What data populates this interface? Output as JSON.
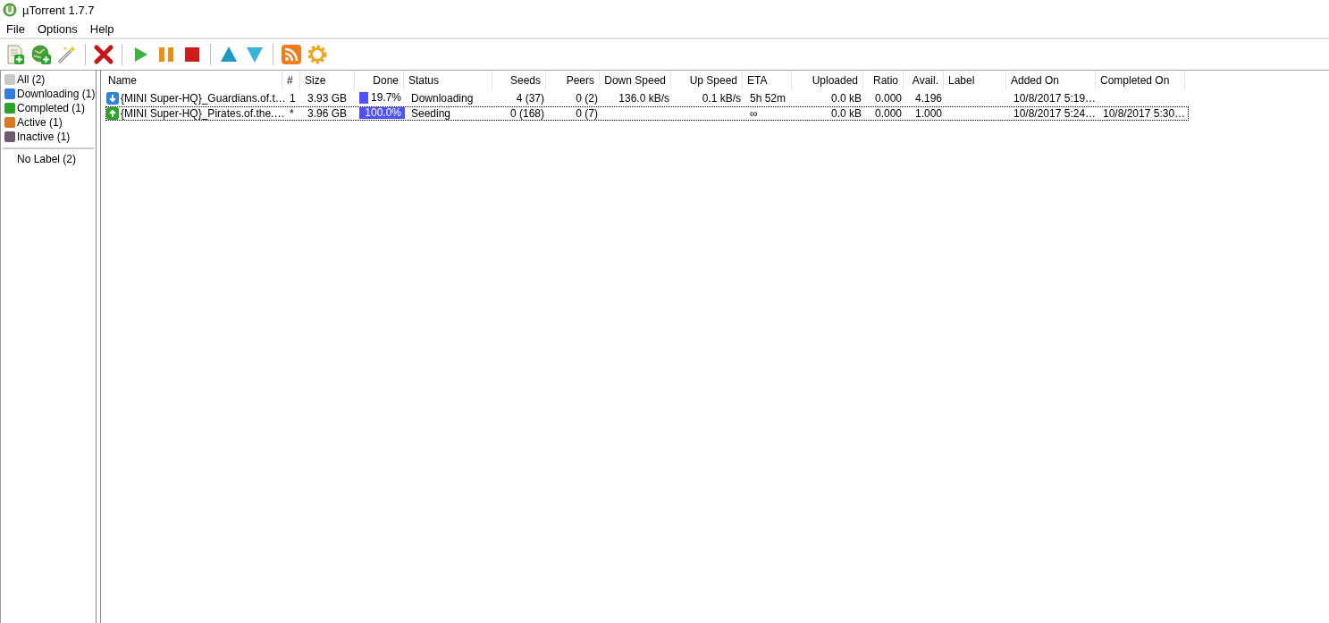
{
  "window": {
    "title": "µTorrent 1.7.7"
  },
  "menu": [
    "File",
    "Options",
    "Help"
  ],
  "sidebar": {
    "items": [
      {
        "label": "All (2)",
        "kind": "all"
      },
      {
        "label": "Downloading (1)",
        "kind": "downloading"
      },
      {
        "label": "Completed (1)",
        "kind": "completed"
      },
      {
        "label": "Active (1)",
        "kind": "active"
      },
      {
        "label": "Inactive (1)",
        "kind": "inactive"
      }
    ],
    "labels": [
      "No Label (2)"
    ]
  },
  "table": {
    "columns": [
      "Name",
      "#",
      "Size",
      "Done",
      "Status",
      "Seeds",
      "Peers",
      "Down Speed",
      "Up Speed",
      "ETA",
      "Uploaded",
      "Ratio",
      "Avail.",
      "Label",
      "Added On",
      "Completed On"
    ],
    "rows": [
      {
        "kind": "downloading",
        "focused": false,
        "name": "{MINI Super-HQ}_Guardians.of.t…",
        "queue": "1",
        "size": "3.93 GB",
        "level": 0.197,
        "done": "19.7%",
        "status": "Downloading",
        "seeds": "4 (37)",
        "peers": "0 (2)",
        "down_speed": "136.0 kB/s",
        "up_speed": "0.1 kB/s",
        "eta": "5h 52m",
        "uploaded": "0.0 kB",
        "ratio": "0.000",
        "avail": "4.196",
        "label": "",
        "added_on": "10/8/2017 5:19…",
        "completed_on": ""
      },
      {
        "kind": "seeding",
        "focused": true,
        "name": "{MINI Super-HQ}_Pirates.of.the.…",
        "queue": "*",
        "size": "3.96 GB",
        "level": 1.0,
        "done": "100.0%",
        "status": "Seeding",
        "seeds": "0 (168)",
        "peers": "0 (7)",
        "down_speed": "",
        "up_speed": "",
        "eta": "∞",
        "uploaded": "0.0 kB",
        "ratio": "0.000",
        "avail": "1.000",
        "label": "",
        "added_on": "10/8/2017 5:24…",
        "completed_on": "10/8/2017 5:30…"
      }
    ]
  }
}
